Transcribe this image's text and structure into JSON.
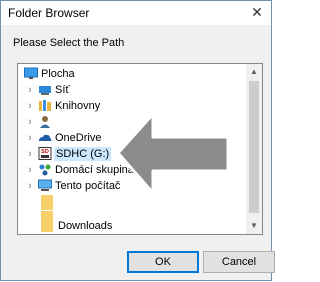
{
  "window": {
    "title": "Folder Browser",
    "close_glyph": "✕"
  },
  "prompt": "Please Select the Path",
  "tree": {
    "items": [
      {
        "label": "Plocha",
        "icon": "desktop-icon",
        "expandable": false
      },
      {
        "label": "Síť",
        "icon": "network-icon",
        "expandable": true
      },
      {
        "label": "Knihovny",
        "icon": "libraries-icon",
        "expandable": true
      },
      {
        "label": "",
        "icon": "user-icon",
        "expandable": true
      },
      {
        "label": "OneDrive",
        "icon": "onedrive-icon",
        "expandable": true
      },
      {
        "label": "SDHC (G:)",
        "icon": "sd-card-icon",
        "expandable": true,
        "selected": true
      },
      {
        "label": "Domácí skupina",
        "icon": "homegroup-icon",
        "expandable": true
      },
      {
        "label": "Tento počítač",
        "icon": "this-pc-icon",
        "expandable": true
      },
      {
        "label": "",
        "icon": "folder-icon",
        "expandable": false
      },
      {
        "label": "",
        "icon": "folder-icon",
        "expandable": false
      },
      {
        "label": "Downloads",
        "icon": "folder-icon",
        "expandable": false
      }
    ]
  },
  "buttons": {
    "ok": "OK",
    "cancel": "Cancel"
  },
  "colors": {
    "selection": "#cce8ff",
    "arrow": "#8c8c8c",
    "ok_border": "#0078d7"
  }
}
